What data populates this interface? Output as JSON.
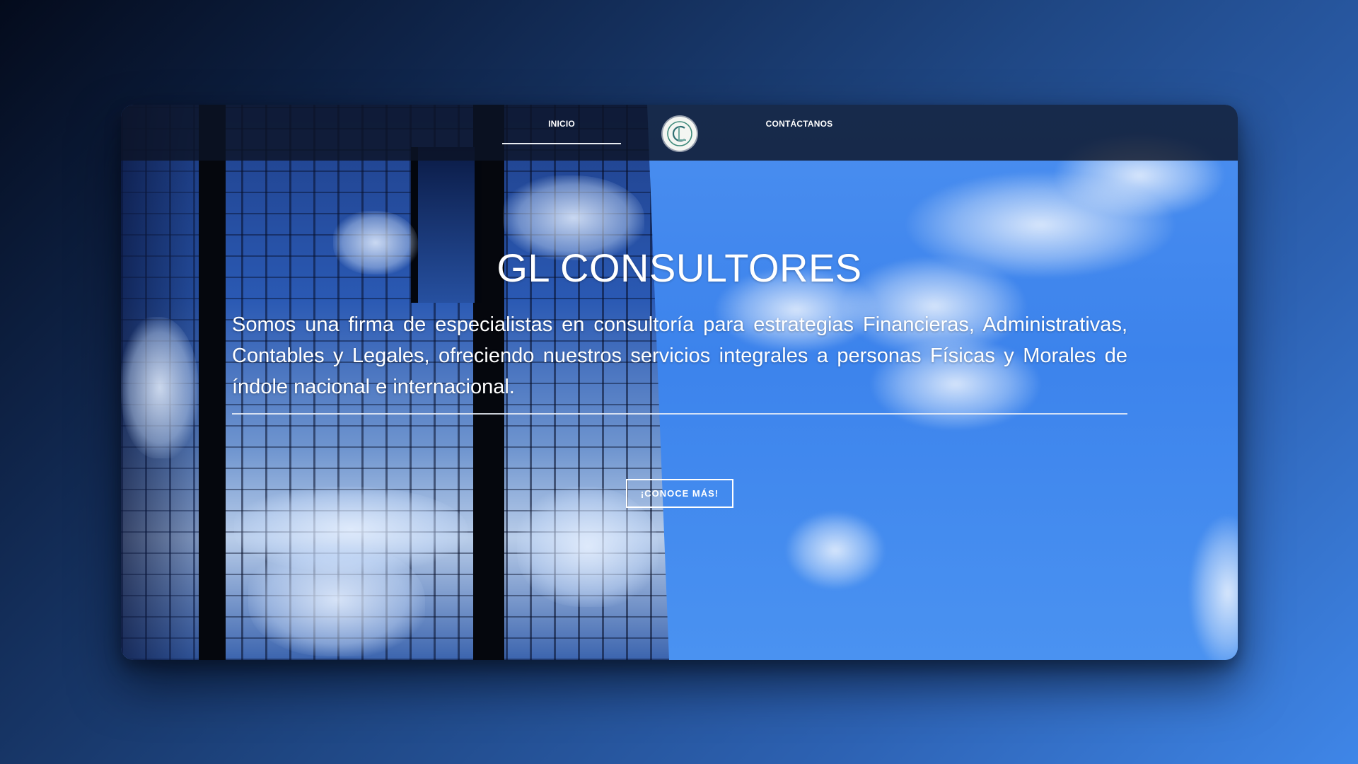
{
  "nav": {
    "items": [
      {
        "label": "INICIO",
        "active": true
      },
      {
        "label": "CONTÁCTANOS",
        "active": false
      }
    ],
    "logo_icon": "gl-consultores-logo"
  },
  "hero": {
    "title": "GL CONSULTORES",
    "description": "Somos una firma de especialistas en consultoría para estrategias Financieras, Administrativas, Contables y Legales, ofreciendo nuestros servicios integrales a personas Físicas y Morales de índole nacional e internacional.",
    "cta_label": "¡CONOCE MÁS!"
  },
  "colors": {
    "page_background": "#1f4784",
    "sky": "#3c83ec",
    "navbar": "#0c1426",
    "text": "#ffffff",
    "logo_accent": "#3d8a7a"
  }
}
